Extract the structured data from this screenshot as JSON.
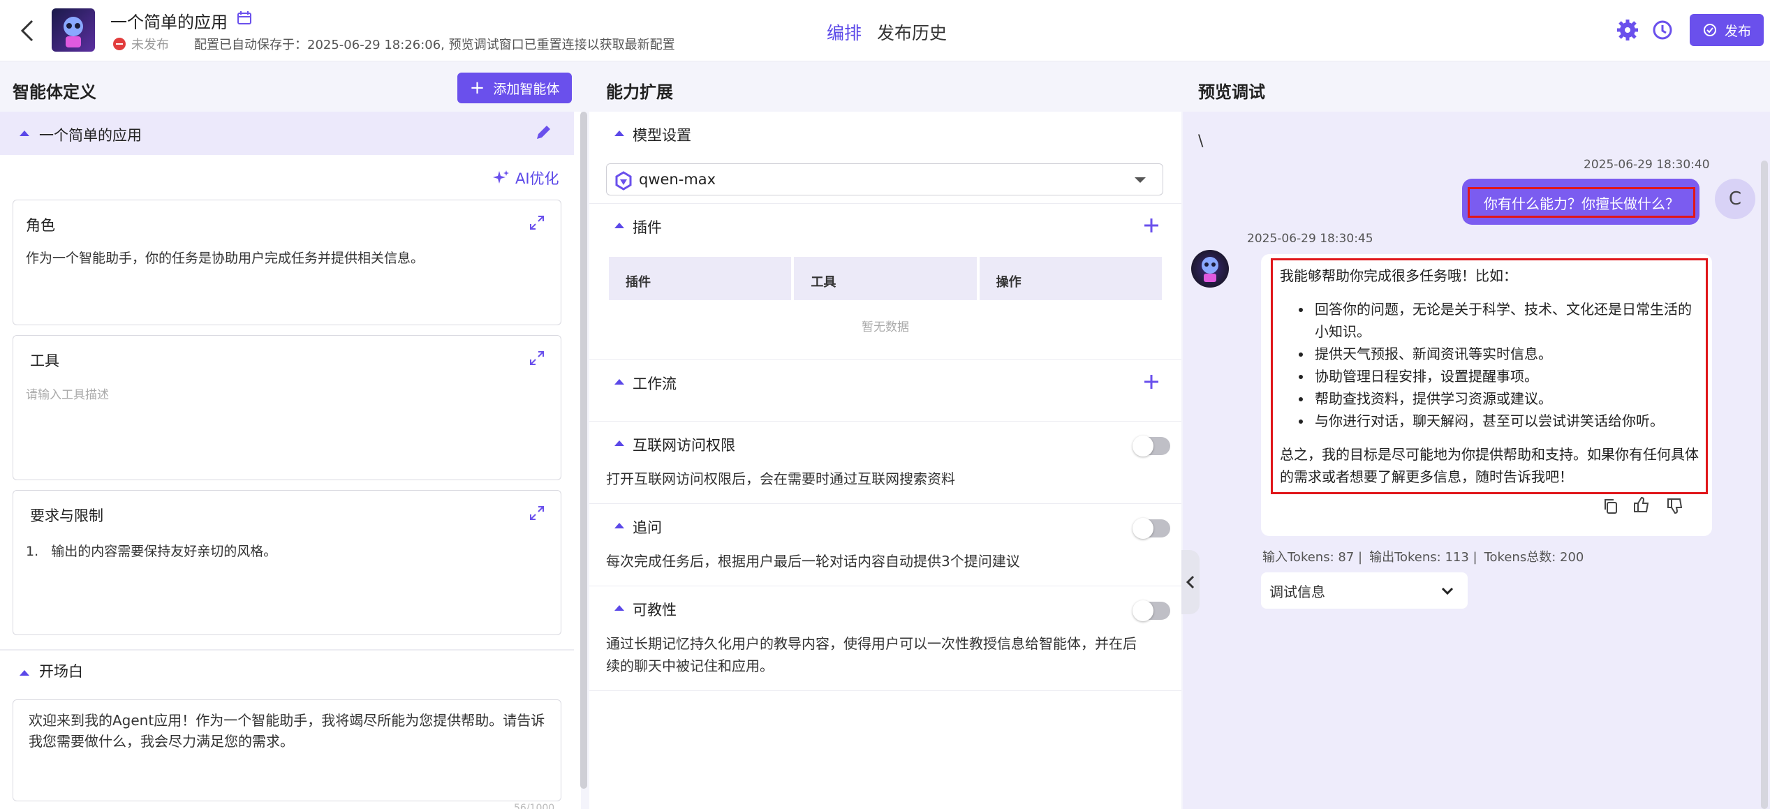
{
  "header": {
    "app_name": "一个简单的应用",
    "status": "未发布",
    "autosave": "配置已自动保存于：2025-06-29 18:26:06, 预览调试窗口已重置连接以获取最新配置",
    "tabs": [
      "编排",
      "发布历史"
    ],
    "publish_label": "发布"
  },
  "left": {
    "title": "智能体定义",
    "add_agent_label": "添加智能体",
    "agent_name": "一个简单的应用",
    "ai_optimize_label": "AI优化",
    "role": {
      "title": "角色",
      "body": "作为一个智能助手，你的任务是协助用户完成任务并提供相关信息。"
    },
    "tools": {
      "title": "工具",
      "placeholder": "请输入工具描述"
    },
    "requirements": {
      "title": "要求与限制",
      "items": [
        "输出的内容需要保持友好亲切的风格。"
      ]
    },
    "opening": {
      "title": "开场白",
      "body": "欢迎来到我的Agent应用！作为一个智能助手，我将竭尽所能为您提供帮助。请告诉我您需要做什么，我会尽力满足您的需求。",
      "counter": "56/1000"
    }
  },
  "middle": {
    "title": "能力扩展",
    "model": {
      "title": "模型设置",
      "value": "qwen-max"
    },
    "plugins": {
      "title": "插件",
      "columns": [
        "插件",
        "工具",
        "操作"
      ],
      "empty": "暂无数据"
    },
    "workflow": {
      "title": "工作流"
    },
    "internet": {
      "title": "互联网访问权限",
      "desc": "打开互联网访问权限后，会在需要时通过互联网搜索资料",
      "enabled": false
    },
    "followup": {
      "title": "追问",
      "desc": "每次完成任务后，根据用户最后一轮对话内容自动提供3个提问建议",
      "enabled": false
    },
    "teachable": {
      "title": "可教性",
      "desc_line1": "通过长期记忆持久化用户的教导内容，使得用户可以一次性教授信息给智能体，并在后",
      "desc_line2": "续的聊天中被记住和应用。",
      "enabled": false
    }
  },
  "right": {
    "title": "预览调试",
    "stray_char": "\\",
    "user_time": "2025-06-29 18:30:40",
    "user_msg": "你有什么能力？你擅长做什么？",
    "user_initial": "C",
    "bot_time": "2025-06-29 18:30:45",
    "bot_intro": "我能够帮助你完成很多任务哦！比如：",
    "bot_items": [
      "回答你的问题，无论是关于科学、技术、文化还是日常生活的小知识。",
      "提供天气预报、新闻资讯等实时信息。",
      "协助管理日程安排，设置提醒事项。",
      "帮助查找资料，提供学习资源或建议。",
      "与你进行对话，聊天解闷，甚至可以尝试讲笑话给你听。"
    ],
    "bot_outro": "总之，我的目标是尽可能地为你提供帮助和支持。如果你有任何具体的需求或者想要了解更多信息，随时告诉我吧！",
    "tokens_in": "输入Tokens: 87 |",
    "tokens_out": "输出Tokens: 113 |",
    "tokens_total": "Tokens总数: 200",
    "debug_label": "调试信息"
  },
  "colors": {
    "accent": "#6a50ec",
    "highlight": "#e0171b"
  }
}
